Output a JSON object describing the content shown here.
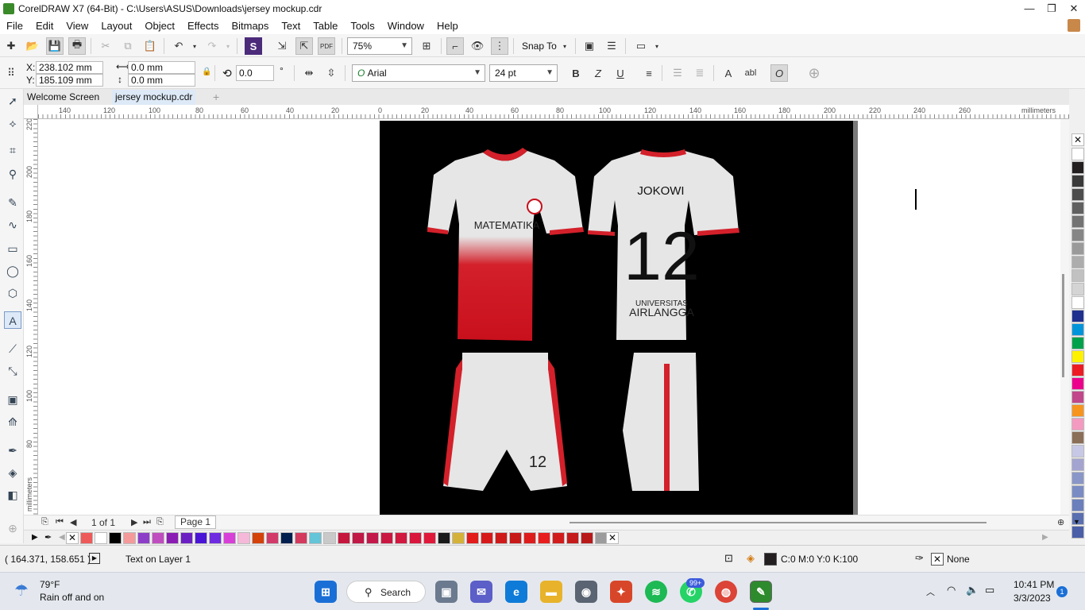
{
  "titlebar": {
    "title": "CorelDRAW X7 (64-Bit) - C:\\Users\\ASUS\\Downloads\\jersey mockup.cdr",
    "min": "—",
    "restore": "❐",
    "close": "✕"
  },
  "menu": [
    "File",
    "Edit",
    "View",
    "Layout",
    "Object",
    "Effects",
    "Bitmaps",
    "Text",
    "Table",
    "Tools",
    "Window",
    "Help"
  ],
  "stdbar": {
    "zoom": "75%",
    "snap_to": "Snap To"
  },
  "propbar": {
    "x_label": "X:",
    "x_value": "238.102 mm",
    "y_label": "Y:",
    "y_value": "185.109 mm",
    "w_value": "0.0 mm",
    "h_value": "0.0 mm",
    "rotation": "0.0",
    "degree": "°",
    "font": "Arial",
    "font_size": "24 pt",
    "bold": "B",
    "italic": "Z",
    "underline": "U",
    "abl": "abl"
  },
  "tabs": [
    "Welcome Screen",
    "jersey mockup.cdr"
  ],
  "ruler": {
    "units": "millimeters",
    "h_labels": [
      "140",
      "120",
      "100",
      "80",
      "60",
      "40",
      "20",
      "0",
      "20",
      "40",
      "60",
      "80",
      "100",
      "120",
      "140",
      "160",
      "180",
      "200",
      "220",
      "240",
      "260",
      "280"
    ],
    "v_labels": [
      "220",
      "200",
      "180",
      "160",
      "140",
      "120",
      "100",
      "80"
    ]
  },
  "jersey": {
    "front_text": "MATEMATIKA",
    "back_name": "JOKOWI",
    "back_number": "12",
    "back_line1": "UNIVERSITAS",
    "back_line2": "AIRLANGGA",
    "shorts_number": "12"
  },
  "navigator": {
    "page_count": "1 of 1",
    "page_tab": "Page 1"
  },
  "status": {
    "coords": "( 164.371, 158.651 )",
    "layer_info": "Text on Layer 1",
    "fill_info": "C:0 M:0 Y:0 K:100",
    "outline_info": "None"
  },
  "taskbar": {
    "weather_temp": "79°F",
    "weather_desc": "Rain off and on",
    "search": "Search",
    "whatsapp_badge": "99+",
    "time": "10:41 PM",
    "date": "3/3/2023",
    "notif_count": "1"
  },
  "colors": {
    "right_palette": [
      "#ffffff",
      "#231f20",
      "#3a3a3a",
      "#4d4d4d",
      "#606060",
      "#737373",
      "#868686",
      "#9a9a9a",
      "#adadad",
      "#c1c1c1",
      "#d4d4d4",
      "#ffffff",
      "#1e2f8f",
      "#0095da",
      "#00a14b",
      "#fff200",
      "#ed1c24",
      "#ec008c",
      "#c2478a",
      "#f7941d",
      "#f49ac1",
      "#8b6e57",
      "#c7c8e6",
      "#a4a4d1",
      "#8a96c8",
      "#7b8cc4",
      "#6a7fbc",
      "#5a6fb0",
      "#4a5fa8"
    ],
    "bottom_palette": [
      "#ee5a5a",
      "#ffffff",
      "#000000",
      "#f49a9a",
      "#8d3ec8",
      "#c04dc0",
      "#8b1db5",
      "#6a1fc2",
      "#4a14d6",
      "#6e2be0",
      "#d83fd8",
      "#f5b8d8",
      "#d4420a",
      "#d23a6a",
      "#001f4e",
      "#d33a5e",
      "#64c4d8",
      "#c9c9c9",
      "#c6163e",
      "#c11846",
      "#c3184a",
      "#c91742",
      "#d1183f",
      "#d9163c",
      "#e0183a",
      "#1a1a1a",
      "#d4b23a",
      "#e21b1b",
      "#d61a1a",
      "#cf1a1a",
      "#c81919",
      "#de1c1c",
      "#e81e1e",
      "#d21c1c",
      "#c51b1b",
      "#b81a1a",
      "#9c9c9c"
    ]
  }
}
